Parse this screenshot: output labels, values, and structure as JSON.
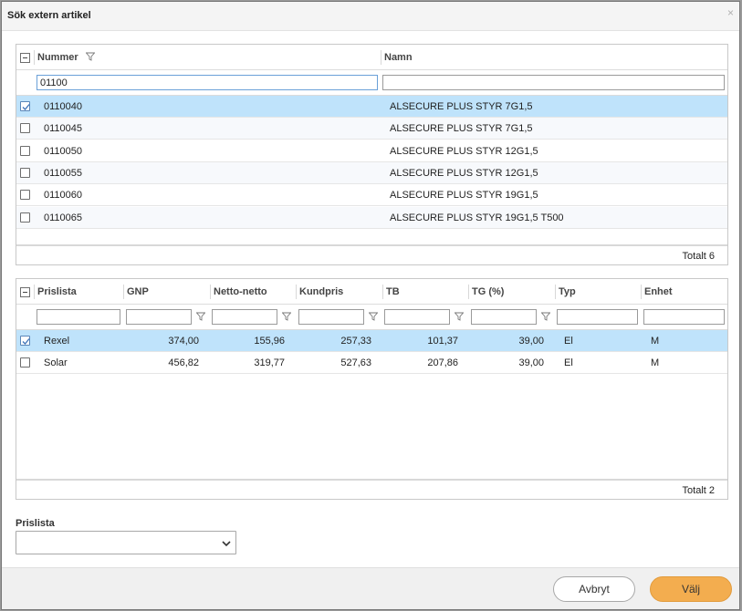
{
  "dialog": {
    "title": "Sök extern artikel",
    "close_icon": "×"
  },
  "article_grid": {
    "columns": [
      "Nummer",
      "Namn"
    ],
    "filters": {
      "nummer": "01100",
      "namn": ""
    },
    "rows": [
      {
        "nummer": "0110040",
        "namn": "ALSECURE PLUS STYR 7G1,5",
        "checked": true
      },
      {
        "nummer": "0110045",
        "namn": "ALSECURE PLUS STYR 7G1,5",
        "checked": false
      },
      {
        "nummer": "0110050",
        "namn": "ALSECURE PLUS STYR 12G1,5",
        "checked": false
      },
      {
        "nummer": "0110055",
        "namn": "ALSECURE PLUS STYR 12G1,5",
        "checked": false
      },
      {
        "nummer": "0110060",
        "namn": "ALSECURE PLUS STYR 19G1,5",
        "checked": false
      },
      {
        "nummer": "0110065",
        "namn": "ALSECURE PLUS STYR 19G1,5 T500",
        "checked": false
      }
    ],
    "total": "Totalt 6"
  },
  "price_grid": {
    "columns": [
      "Prislista",
      "GNP",
      "Netto-netto",
      "Kundpris",
      "TB",
      "TG (%)",
      "Typ",
      "Enhet"
    ],
    "rows": [
      {
        "prislista": "Rexel",
        "gnp": "374,00",
        "netto": "155,96",
        "kundpris": "257,33",
        "tb": "101,37",
        "tg": "39,00",
        "typ": "El",
        "enhet": "M",
        "checked": true
      },
      {
        "prislista": "Solar",
        "gnp": "456,82",
        "netto": "319,77",
        "kundpris": "527,63",
        "tb": "207,86",
        "tg": "39,00",
        "typ": "El",
        "enhet": "M",
        "checked": false
      }
    ],
    "total": "Totalt 2"
  },
  "prislista_field": {
    "label": "Prislista",
    "value": ""
  },
  "buttons": {
    "cancel": "Avbryt",
    "ok": "Välj"
  },
  "colors": {
    "selected_row": "#bfe3fb",
    "primary_button": "#f3ad4f"
  }
}
